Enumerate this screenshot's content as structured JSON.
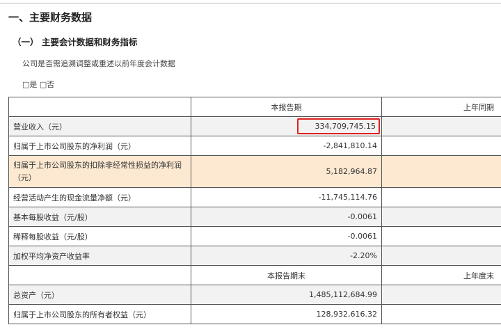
{
  "section_title": "一、主要财务数据",
  "subsection_title": "（一） 主要会计数据和财务指标",
  "question": "公司是否需追溯调整或重述以前年度会计数据",
  "options": "□是 □否",
  "header1": {
    "current": "本报告期",
    "previous": "上年同期"
  },
  "header2": {
    "current": "本报告期末",
    "previous": "上年度末"
  },
  "rows": [
    {
      "label": "营业收入（元）",
      "value": "334,709,745.15"
    },
    {
      "label": "归属于上市公司股东的净利润（元）",
      "value": "-2,841,810.14"
    },
    {
      "label": "归属于上市公司股东的扣除非经常性损益的净利润（元）",
      "value": "5,182,964.87"
    },
    {
      "label": "经营活动产生的现金流量净额（元）",
      "value": "-11,745,114.76"
    },
    {
      "label": "基本每股收益（元/股）",
      "value": "-0.0061"
    },
    {
      "label": "稀释每股收益（元/股）",
      "value": "-0.0061"
    },
    {
      "label": "加权平均净资产收益率",
      "value": "-2.20%"
    },
    {
      "label": "总资产（元）",
      "value": "1,485,112,684.99"
    },
    {
      "label": "归属于上市公司股东的所有者权益（元）",
      "value": "128,932,616.32"
    }
  ]
}
